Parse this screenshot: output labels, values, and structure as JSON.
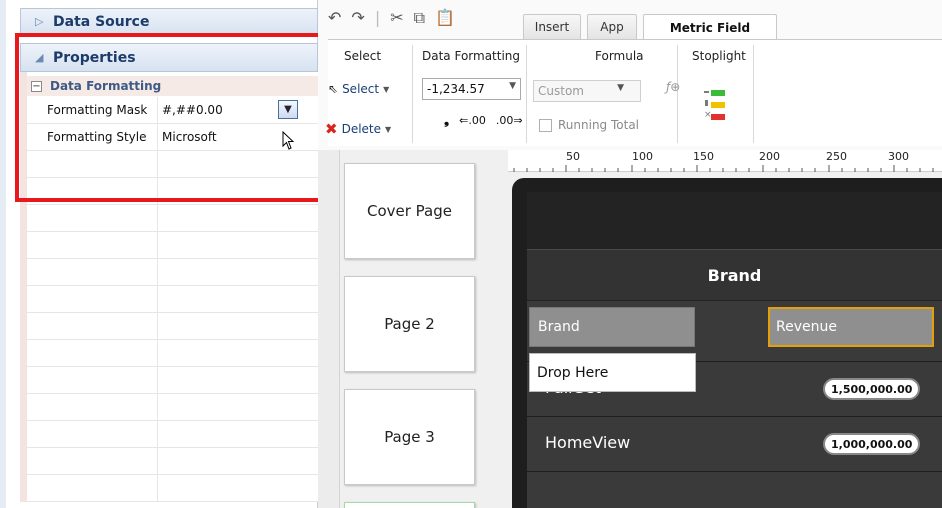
{
  "left_panel": {
    "data_source_header": "Data Source",
    "properties_header": "Properties",
    "section": "Data Formatting",
    "rows": [
      {
        "label": "Formatting Mask",
        "value": "#,##0.00"
      },
      {
        "label": "Formatting Style",
        "value": "Microsoft"
      }
    ]
  },
  "ribbon": {
    "tabs": [
      "Insert",
      "App",
      "Metric Field"
    ],
    "active_tab": "Metric Field",
    "groups": {
      "select": {
        "title": "Select",
        "select_label": "Select",
        "delete_label": "Delete"
      },
      "data_formatting": {
        "title": "Data Formatting",
        "format_value": "-1,234.57"
      },
      "formula": {
        "title": "Formula",
        "formula_value": "Custom",
        "running_total": "Running Total"
      },
      "stoplight": {
        "title": "Stoplight"
      }
    }
  },
  "ruler": {
    "ticks": [
      "50",
      "100",
      "150",
      "200",
      "250",
      "300"
    ]
  },
  "pages": [
    "Cover Page",
    "Page 2",
    "Page 3"
  ],
  "canvas": {
    "title": "Brand",
    "columns": [
      "Brand",
      "Revenue"
    ],
    "drop_here": "Drop Here",
    "rows": [
      {
        "name": "PairSet",
        "value": "1,500,000.00"
      },
      {
        "name": "HomeView",
        "value": "1,000,000.00"
      }
    ]
  },
  "colors": {
    "highlight": "#e8191c",
    "selected_column_border": "#e3a008",
    "stoplight": [
      "#3cba3c",
      "#f2c200",
      "#e53030"
    ]
  }
}
